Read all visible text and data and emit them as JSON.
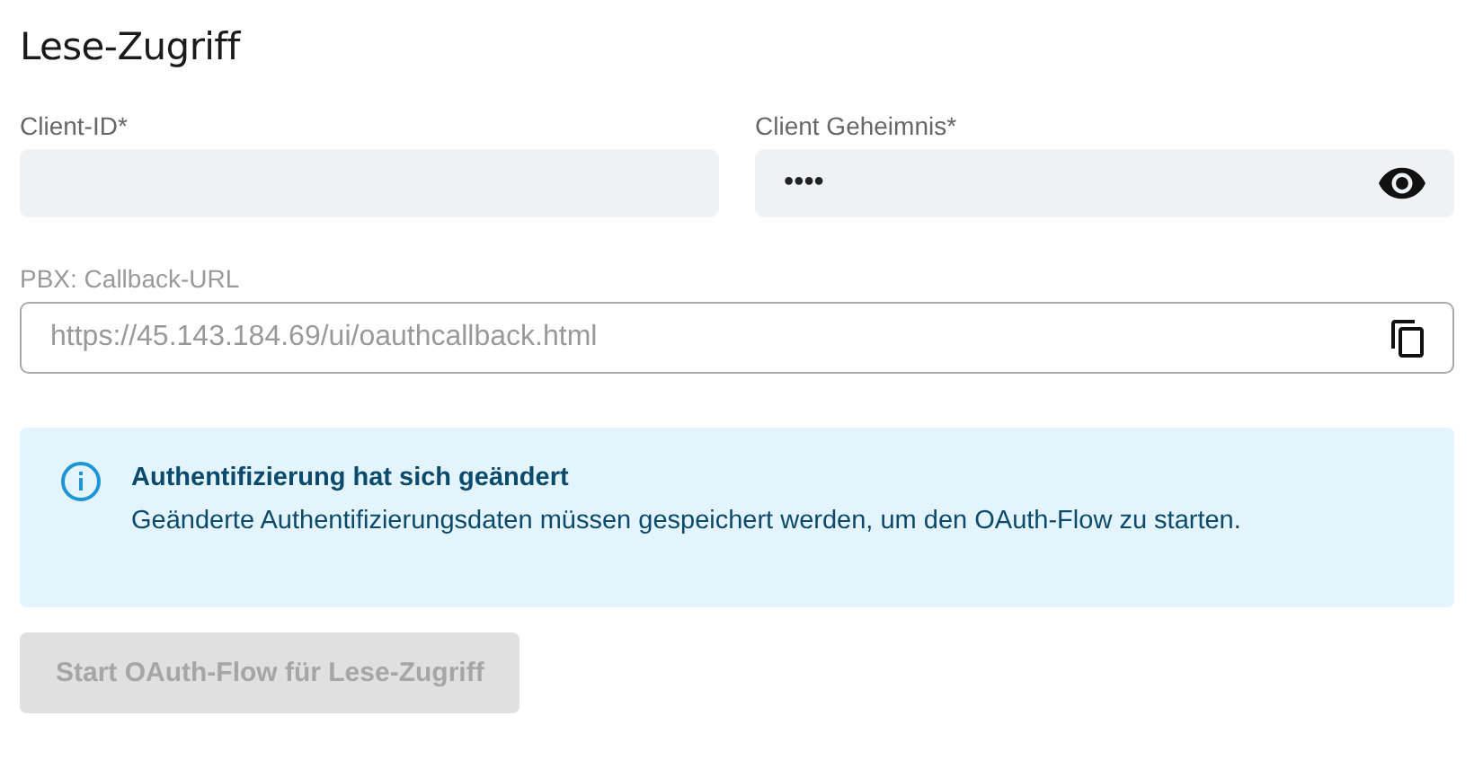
{
  "title": "Lese-Zugriff",
  "fields": [
    {
      "kind": "text",
      "label": "Client-ID*"
    },
    {
      "kind": "secret",
      "label": "Client Geheimnis*",
      "value": "••••"
    },
    {
      "kind": "copyable",
      "label": "PBX: Callback-URL",
      "value": "https://45.143.184.69/ui/oauthcallback.html",
      "disabled": true
    }
  ],
  "alert": {
    "kind": "info",
    "title": "Authentifizierung hat sich geändert",
    "message": "Geänderte Authentifizierungsdaten müssen gespeichert werden, um den OAuth-Flow zu starten."
  },
  "button": {
    "label": "Start OAuth-Flow für Lese-Zugriff",
    "disabled": true
  }
}
